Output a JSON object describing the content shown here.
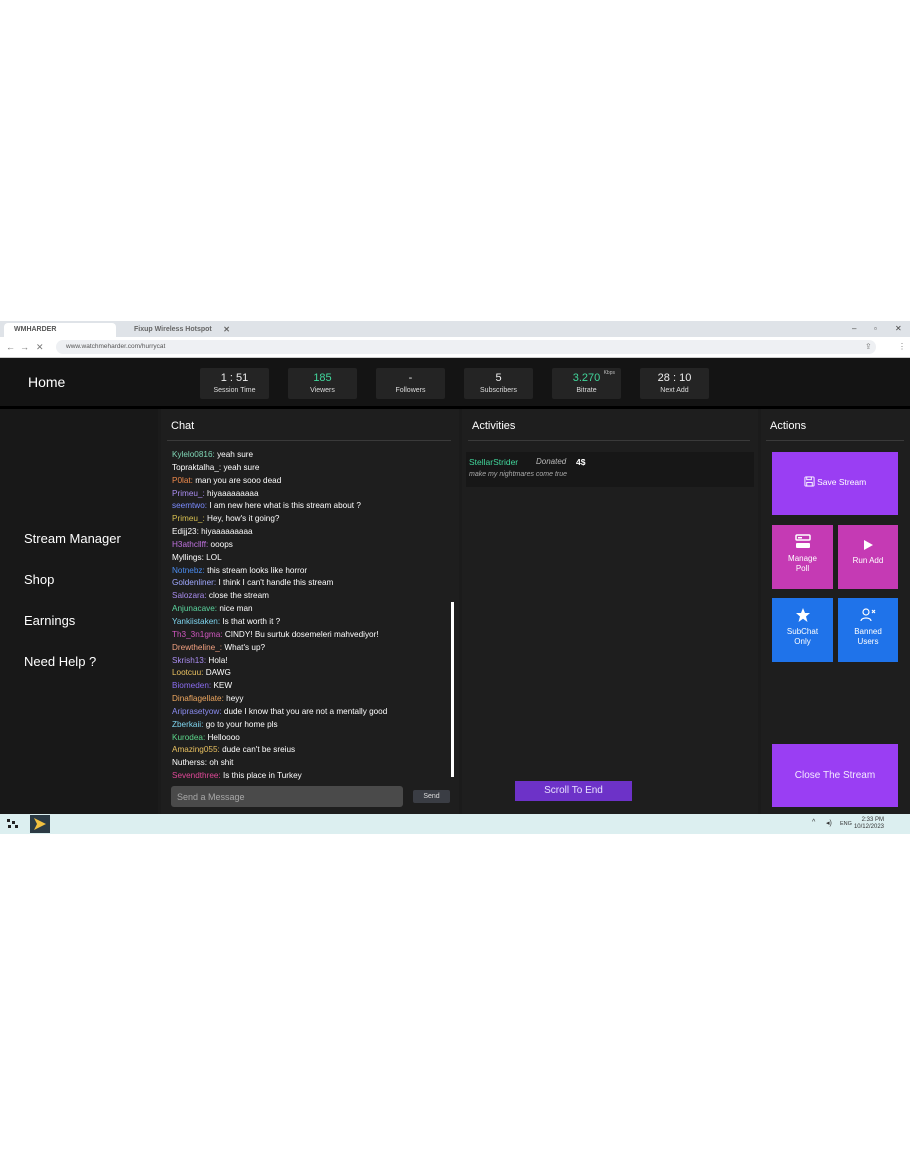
{
  "browser": {
    "tabs": [
      {
        "label": "WMHARDER"
      },
      {
        "label": "Fixup Wireless Hotspot"
      }
    ],
    "url": "www.watchmeharder.com/hurrycat"
  },
  "header": {
    "title": "Home",
    "stats": [
      {
        "value": "1 : 51",
        "label": "Session Time"
      },
      {
        "value": "185",
        "label": "Viewers"
      },
      {
        "value": "-",
        "label": "Followers"
      },
      {
        "value": "5",
        "label": "Subscribers"
      },
      {
        "value": "3.270",
        "label": "Bitrate",
        "unit": "Kbps"
      },
      {
        "value": "28 : 10",
        "label": "Next Add"
      }
    ]
  },
  "sidebar": {
    "items": [
      {
        "label": "Stream Manager"
      },
      {
        "label": "Shop"
      },
      {
        "label": "Earnings"
      },
      {
        "label": "Need Help ?"
      }
    ]
  },
  "chat": {
    "title": "Chat",
    "placeholder": "Send a Message",
    "send_label": "Send",
    "messages": [
      {
        "user": "Kylelo0816:",
        "text": "yeah sure",
        "color": "#7fd6b5"
      },
      {
        "user": "Topraktalha_:",
        "text": "yeah sure",
        "color": "#ffffff"
      },
      {
        "user": "P0lat:",
        "text": "man you are sooo dead",
        "color": "#f08a4b"
      },
      {
        "user": "Primeu_:",
        "text": "hiyaaaaaaaaa",
        "color": "#a98cf0"
      },
      {
        "user": "seemtwo:",
        "text": "I am new here what is this stream about ?",
        "color": "#7b8cff"
      },
      {
        "user": "Primeu_:",
        "text": "Hey, how's it going?",
        "color": "#d8c050"
      },
      {
        "user": "Edijj23:",
        "text": "hiyaaaaaaaaa",
        "color": "#ffffff"
      },
      {
        "user": "H3athcllff:",
        "text": "ooops",
        "color": "#c072e0"
      },
      {
        "user": "Myllings:",
        "text": "LOL",
        "color": "#ffffff"
      },
      {
        "user": "Notnebz:",
        "text": "this stream looks like horror",
        "color": "#4a8cf0"
      },
      {
        "user": "Goldenliner:",
        "text": "I think I can't handle this stream",
        "color": "#a0a8ff"
      },
      {
        "user": "Salozara:",
        "text": "close the stream",
        "color": "#a98cf0"
      },
      {
        "user": "Anjunacave:",
        "text": "nice man",
        "color": "#5bd6a0"
      },
      {
        "user": "Yankiistaken:",
        "text": "Is that worth it ?",
        "color": "#7fd6f0"
      },
      {
        "user": "Th3_3n1gma:",
        "text": "CINDY! Bu surtuk dosemeleri mahvediyor!",
        "color": "#d058c0"
      },
      {
        "user": "Drewtheline_:",
        "text": "What's up?",
        "color": "#f0a080"
      },
      {
        "user": "Skrish13:",
        "text": "Hola!",
        "color": "#a98cf0"
      },
      {
        "user": "Lootcuu:",
        "text": "DAWG",
        "color": "#e8c060"
      },
      {
        "user": "Biomeden:",
        "text": "KEW",
        "color": "#8a6cf0"
      },
      {
        "user": "Dinaflagellate:",
        "text": "heyy",
        "color": "#f0a860"
      },
      {
        "user": "Ariprasetyow:",
        "text": "dude I know that you are not a mentally good",
        "color": "#8a8cf0"
      },
      {
        "user": "Zberkaii:",
        "text": "go to your home pls",
        "color": "#7fd6f0"
      },
      {
        "user": "Kurodea:",
        "text": "Helloooo",
        "color": "#5bd68a"
      },
      {
        "user": "Amazing055:",
        "text": "dude can't be sreius",
        "color": "#e8c060"
      },
      {
        "user": "Nutherss:",
        "text": "oh shit",
        "color": "#ffffff"
      },
      {
        "user": "Sevendthree:",
        "text": "Is this place in Turkey",
        "color": "#e04898"
      }
    ]
  },
  "activities": {
    "title": "Activities",
    "item": {
      "user": "StellarStrider",
      "action": "Donated",
      "amount": "4$",
      "note": "make my nightmares come true"
    },
    "scroll_label": "Scroll To End"
  },
  "actions": {
    "title": "Actions",
    "save": "Save Stream",
    "poll_line1": "Manage",
    "poll_line2": "Poll",
    "run_add": "Run Add",
    "subchat_line1": "SubChat",
    "subchat_line2": "Only",
    "banned_line1": "Banned",
    "banned_line2": "Users",
    "close": "Close The Stream"
  },
  "taskbar": {
    "lang": "ENG",
    "time": "2:33 PM",
    "date": "10/12/2023"
  }
}
